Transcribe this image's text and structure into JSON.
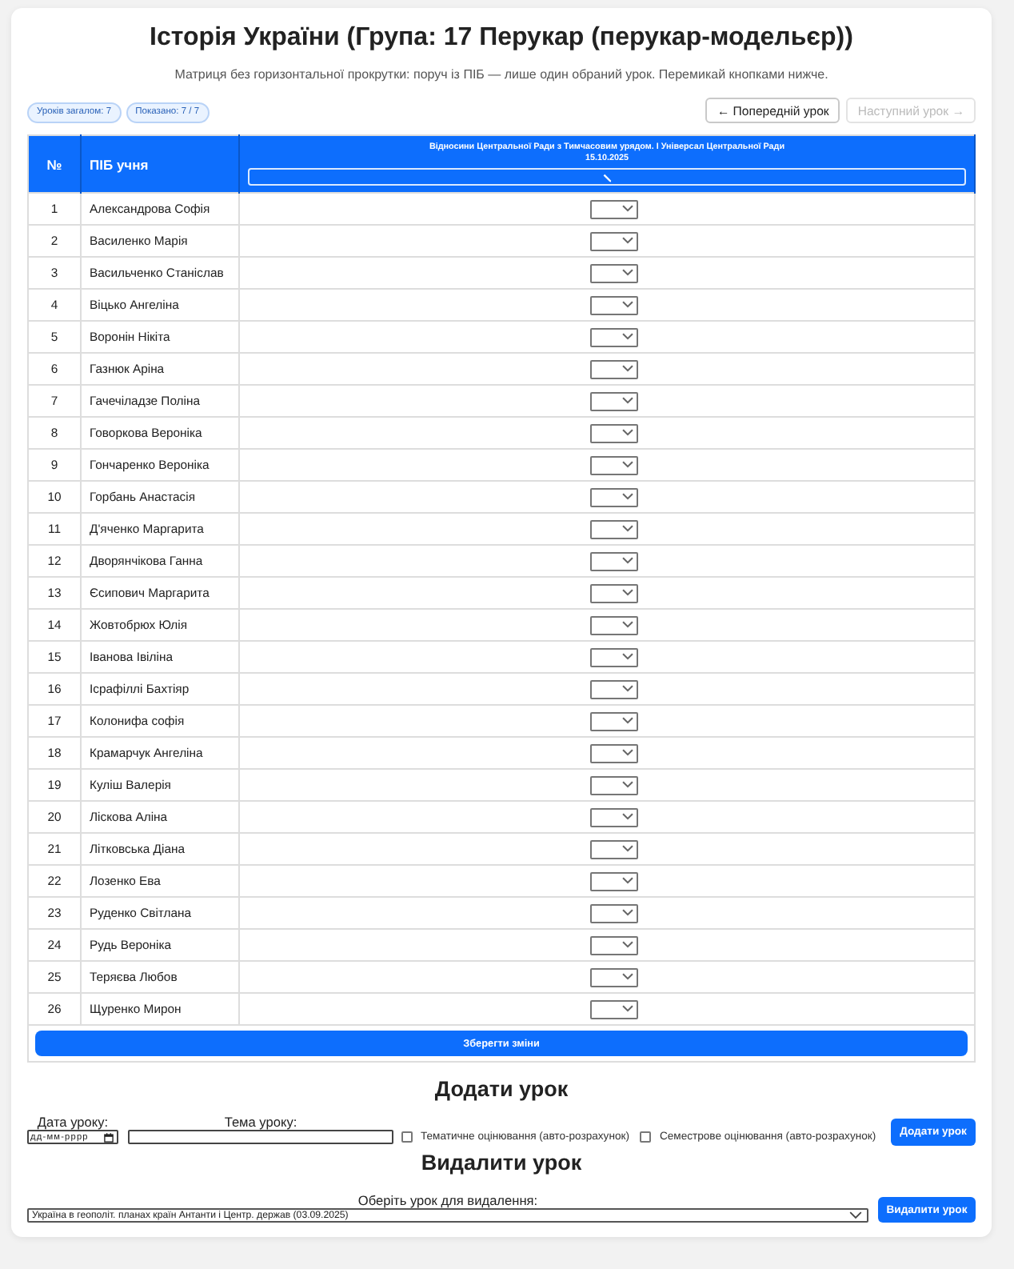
{
  "page": {
    "title": "Історія України (Група: 17 Перукар (перукар-модельєр))",
    "subtitle": "Матриця без горизонтальної прокрутки: поруч із ПІБ — лише один обраний урок. Перемикай кнопками нижче."
  },
  "badges": [
    "Уроків загалом: 7",
    "Показано: 7 / 7"
  ],
  "navigation": [
    {
      "label": "← Попередній урок",
      "disabled": false
    },
    {
      "label": "Наступний урок →",
      "disabled": true
    }
  ],
  "table": {
    "columns": [
      "№",
      "ПІБ учня"
    ],
    "lesson": {
      "title": "Відносини Центральної Ради з Тимчасовим урядом. I Універсал Центральної Ради",
      "date": "15.10.2025"
    },
    "rows": [
      {
        "number": "1",
        "name": "Александрова Софія"
      },
      {
        "number": "2",
        "name": "Василенко Марія"
      },
      {
        "number": "3",
        "name": "Васильченко Станіслав"
      },
      {
        "number": "4",
        "name": "Віцько Ангеліна"
      },
      {
        "number": "5",
        "name": "Воронін Нікіта"
      },
      {
        "number": "6",
        "name": "Газнюк Аріна"
      },
      {
        "number": "7",
        "name": "Гачечіладзе Поліна"
      },
      {
        "number": "8",
        "name": "Говоркова Вероніка"
      },
      {
        "number": "9",
        "name": "Гончаренко Вероніка"
      },
      {
        "number": "10",
        "name": "Горбань Анастасія"
      },
      {
        "number": "11",
        "name": "Д'яченко Маргарита"
      },
      {
        "number": "12",
        "name": "Дворянчікова Ганна"
      },
      {
        "number": "13",
        "name": "Єсипович Маргарита"
      },
      {
        "number": "14",
        "name": "Жовтобрюх Юлія"
      },
      {
        "number": "15",
        "name": "Іванова Івіліна"
      },
      {
        "number": "16",
        "name": "Ісрафіллі Бахтіяр"
      },
      {
        "number": "17",
        "name": "Колонифа софія"
      },
      {
        "number": "18",
        "name": "Крамарчук Ангеліна"
      },
      {
        "number": "19",
        "name": "Куліш Валерія"
      },
      {
        "number": "20",
        "name": "Ліскова Аліна"
      },
      {
        "number": "21",
        "name": "Літковська Діана"
      },
      {
        "number": "22",
        "name": "Лозенко Ева"
      },
      {
        "number": "23",
        "name": "Руденко Світлана"
      },
      {
        "number": "24",
        "name": "Рудь Вероніка"
      },
      {
        "number": "25",
        "name": "Теряєва Любов"
      },
      {
        "number": "26",
        "name": "Щуренко Мирон"
      }
    ],
    "save_button": "Зберегти зміни"
  },
  "add_lesson": {
    "heading": "Додати урок",
    "date_label": "Дата уроку:",
    "date_field": {
      "placeholder": "дд-мм-рррр"
    },
    "topic_label": "Тема уроку:",
    "options": [
      {
        "label": "Тематичне оцінювання (авто-розрахунок)",
        "checked": false
      },
      {
        "label": "Семестрове оцінювання (авто-розрахунок)",
        "checked": false
      }
    ],
    "button": "Додати урок"
  },
  "delete_lesson": {
    "heading": "Видалити урок",
    "select_label": "Оберіть урок для видалення:",
    "selected_lesson": "Україна в геополіт. планах країн Антанти і Центр. держав (03.09.2025)",
    "button": "Видалити урок"
  }
}
